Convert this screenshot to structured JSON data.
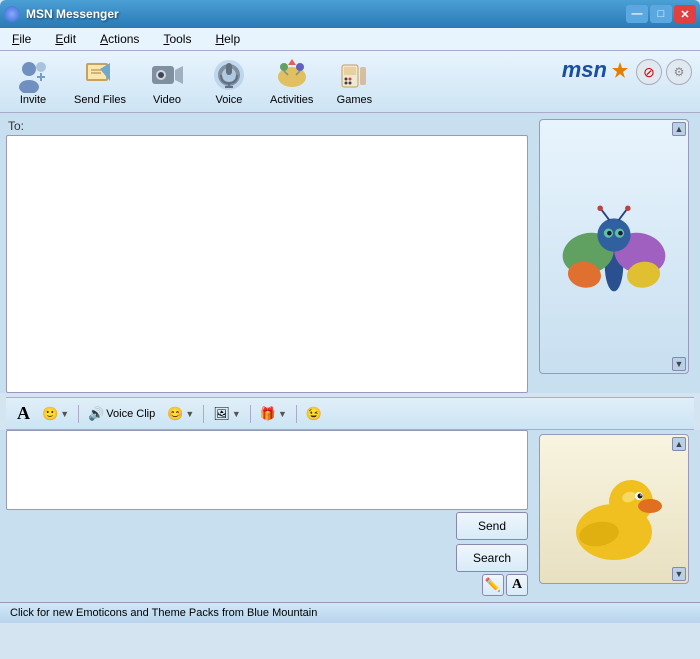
{
  "titlebar": {
    "title": "MSN Messenger",
    "icon": "msn-icon",
    "min_btn": "—",
    "max_btn": "□",
    "close_btn": "✕"
  },
  "menubar": {
    "items": [
      {
        "id": "file",
        "label": "File",
        "underline": "F"
      },
      {
        "id": "edit",
        "label": "Edit",
        "underline": "E"
      },
      {
        "id": "actions",
        "label": "Actions",
        "underline": "A"
      },
      {
        "id": "tools",
        "label": "Tools",
        "underline": "T"
      },
      {
        "id": "help",
        "label": "Help",
        "underline": "H"
      }
    ]
  },
  "toolbar": {
    "items": [
      {
        "id": "invite",
        "label": "Invite",
        "icon": "👤"
      },
      {
        "id": "send-files",
        "label": "Send Files",
        "icon": "🖼️"
      },
      {
        "id": "video",
        "label": "Video",
        "icon": "📹"
      },
      {
        "id": "voice",
        "label": "Voice",
        "icon": "🎧"
      },
      {
        "id": "activities",
        "label": "Activities",
        "icon": "🎵"
      },
      {
        "id": "games",
        "label": "Games",
        "icon": "🃏"
      }
    ],
    "msn_logo": "msn",
    "block_btn": "🚫",
    "settings_btn": "⚙️"
  },
  "chat": {
    "to_label": "To:",
    "messages": ""
  },
  "input_toolbar": {
    "font_btn": "A",
    "emoticon_btn": "😊",
    "voice_clip_btn": "Voice Clip",
    "emoticon2_btn": "😊",
    "image_btn": "🖼",
    "gift_btn": "🎁",
    "wink_btn": "😉"
  },
  "message_input": {
    "placeholder": "",
    "value": ""
  },
  "buttons": {
    "send": "Send",
    "search": "Search"
  },
  "bottom_icons": {
    "pencil": "✏️",
    "font_a": "A"
  },
  "statusbar": {
    "text": "Click for new Emoticons and Theme Packs from Blue Mountain"
  }
}
